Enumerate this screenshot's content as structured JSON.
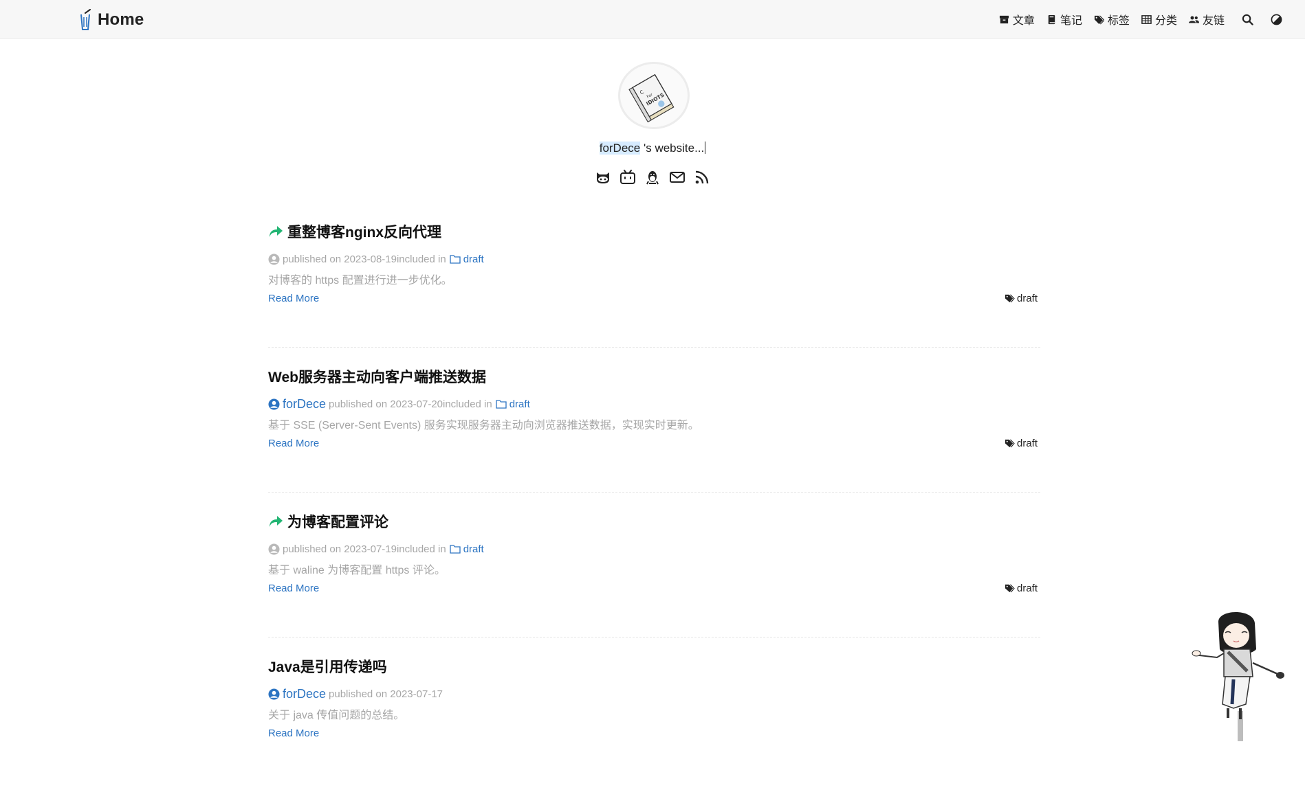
{
  "header": {
    "brand": "Home",
    "nav": [
      {
        "label": "文章",
        "icon": "archive-icon"
      },
      {
        "label": "笔记",
        "icon": "book-icon"
      },
      {
        "label": "标签",
        "icon": "tags-icon"
      },
      {
        "label": "分类",
        "icon": "grid-icon"
      },
      {
        "label": "友链",
        "icon": "users-icon"
      }
    ],
    "search_icon": "search-icon",
    "theme_icon": "theme-toggle-icon"
  },
  "profile": {
    "name": "forDece",
    "tagline_rest": " 's website...",
    "avatar_icon": "book-avatar-icon",
    "socials": [
      "github-icon",
      "bilibili-icon",
      "qq-icon",
      "mail-icon",
      "rss-icon"
    ]
  },
  "colors": {
    "link": "#2c74c2",
    "muted": "#a6a6a6",
    "repost": "#22b573",
    "header_bg": "#f7f7f7"
  },
  "posts": [
    {
      "title": "重整博客nginx反向代理",
      "reposted": true,
      "author": "",
      "date_prefix": "published on 2023-08-19",
      "included_text": " included in",
      "category": "draft",
      "excerpt": "对博客的 https 配置进行进一步优化。",
      "read_more": "Read More",
      "tag": "draft"
    },
    {
      "title": "Web服务器主动向客户端推送数据",
      "reposted": false,
      "author": "forDece",
      "date_prefix": "published on 2023-07-20",
      "included_text": " included in",
      "category": "draft",
      "excerpt": "基于 SSE (Server-Sent Events) 服务实现服务器主动向浏览器推送数据，实现实时更新。",
      "read_more": "Read More",
      "tag": "draft"
    },
    {
      "title": "为博客配置评论",
      "reposted": true,
      "author": "",
      "date_prefix": "published on 2023-07-19",
      "included_text": " included in",
      "category": "draft",
      "excerpt": "基于 waline 为博客配置 https 评论。",
      "read_more": "Read More",
      "tag": "draft"
    },
    {
      "title": "Java是引用传递吗",
      "reposted": false,
      "author": "forDece",
      "date_prefix": "published on 2023-07-17",
      "included_text": "",
      "category": "",
      "excerpt": "关于 java 传值问题的总结。",
      "read_more": "Read More",
      "tag": ""
    }
  ],
  "mascot_icon": "mascot-girl-icon"
}
